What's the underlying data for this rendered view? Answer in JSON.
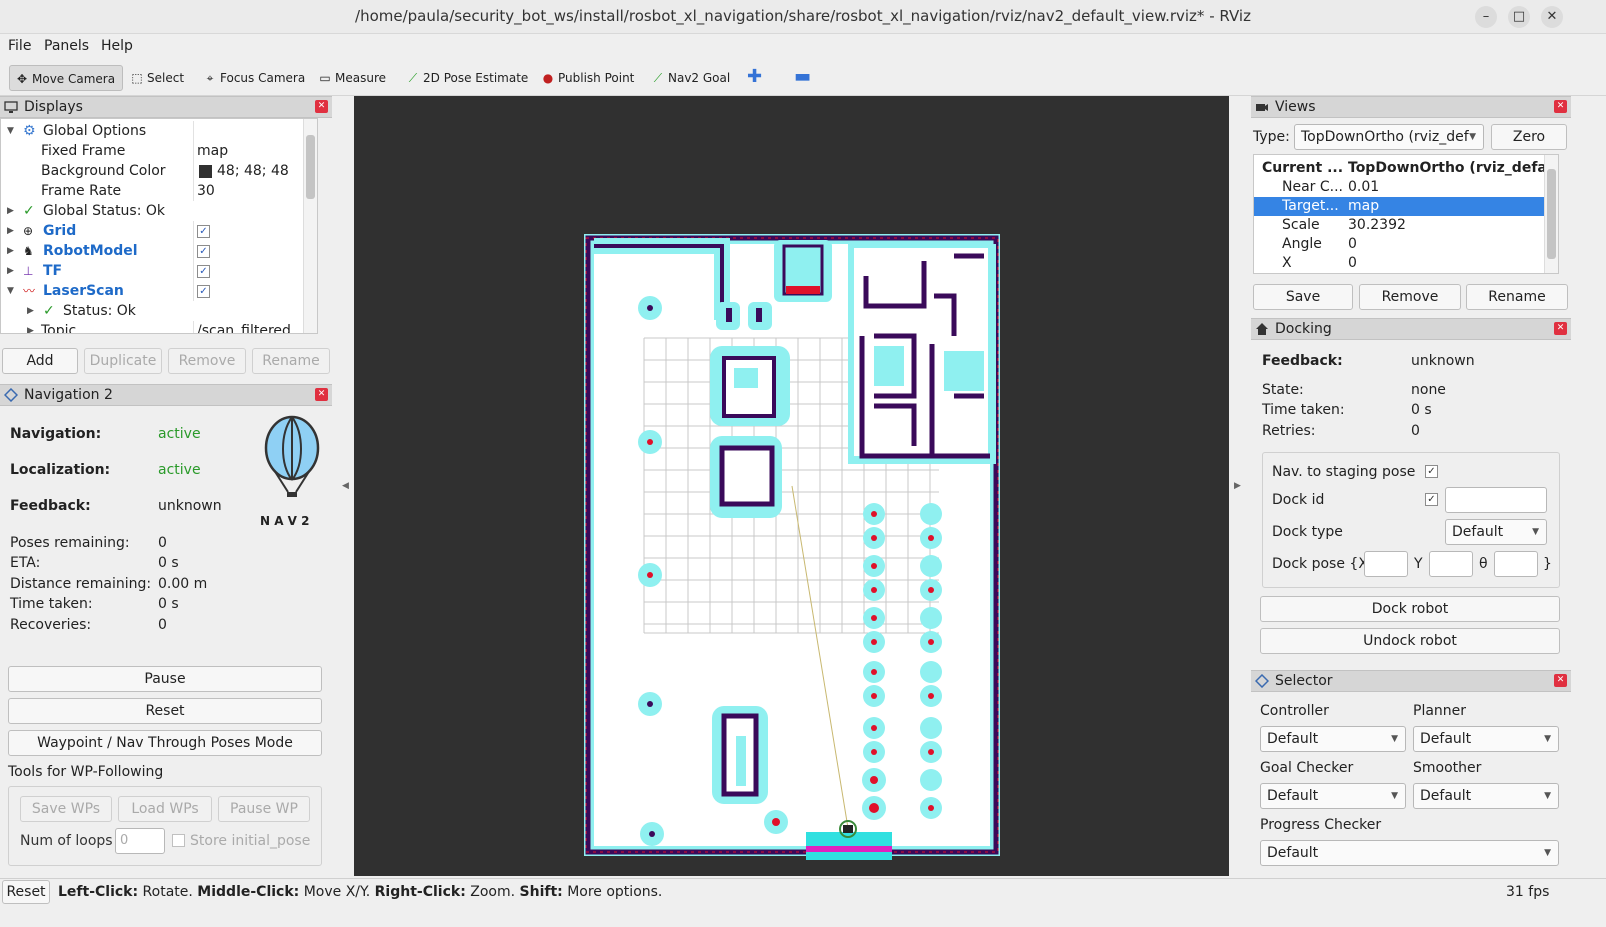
{
  "window": {
    "title": "/home/paula/security_bot_ws/install/rosbot_xl_navigation/share/rosbot_xl_navigation/rviz/nav2_default_view.rviz* - RViz",
    "minimize": "–",
    "maximize": "□",
    "close": "✕"
  },
  "menu": {
    "file": "File",
    "panels": "Panels",
    "help": "Help"
  },
  "toolbar": {
    "move_camera": "Move Camera",
    "select": "Select",
    "focus_camera": "Focus Camera",
    "measure": "Measure",
    "pose_estimate": "2D Pose Estimate",
    "publish_point": "Publish Point",
    "nav2_goal": "Nav2 Goal"
  },
  "displays": {
    "title": "Displays",
    "rows": [
      {
        "label": "Global Options",
        "value": ""
      },
      {
        "label": "Fixed Frame",
        "value": "map"
      },
      {
        "label": "Background Color",
        "value": "48; 48; 48"
      },
      {
        "label": "Frame Rate",
        "value": "30"
      },
      {
        "label": "Global Status: Ok",
        "value": ""
      },
      {
        "label": "Grid",
        "value": ""
      },
      {
        "label": "RobotModel",
        "value": ""
      },
      {
        "label": "TF",
        "value": ""
      },
      {
        "label": "LaserScan",
        "value": ""
      },
      {
        "label": "Status: Ok",
        "value": ""
      },
      {
        "label": "Topic",
        "value": "/scan_filtered"
      }
    ],
    "buttons": {
      "add": "Add",
      "duplicate": "Duplicate",
      "remove": "Remove",
      "rename": "Rename"
    },
    "bg_color": "#303030"
  },
  "nav2": {
    "title": "Navigation 2",
    "navigation_label": "Navigation:",
    "navigation_value": "active",
    "localization_label": "Localization:",
    "localization_value": "active",
    "feedback_label": "Feedback:",
    "feedback_value": "unknown",
    "logo_text": "N A V 2",
    "stats": [
      {
        "label": "Poses remaining:",
        "value": "0"
      },
      {
        "label": "ETA:",
        "value": "0 s"
      },
      {
        "label": "Distance remaining:",
        "value": "0.00 m"
      },
      {
        "label": "Time taken:",
        "value": "0 s"
      },
      {
        "label": "Recoveries:",
        "value": "0"
      }
    ],
    "pause": "Pause",
    "reset": "Reset",
    "waypoint_mode": "Waypoint / Nav Through Poses Mode",
    "wp_title": "Tools for WP-Following",
    "save_wps": "Save WPs",
    "load_wps": "Load WPs",
    "pause_wp": "Pause WP",
    "num_loops_label": "Num of loops",
    "num_loops_value": "0",
    "store_initial_pose": "Store initial_pose"
  },
  "views": {
    "title": "Views",
    "type_label": "Type:",
    "type_value": "TopDownOrtho (rviz_def",
    "zero": "Zero",
    "header_c1": "Current ...",
    "header_c2": "TopDownOrtho (rviz_defaul...",
    "rows": [
      {
        "label": "Near C...",
        "value": "0.01"
      },
      {
        "label": "Target...",
        "value": "map"
      },
      {
        "label": "Scale",
        "value": "30.2392"
      },
      {
        "label": "Angle",
        "value": "0"
      },
      {
        "label": "X",
        "value": "0"
      }
    ],
    "save": "Save",
    "remove": "Remove",
    "rename": "Rename"
  },
  "docking": {
    "title": "Docking",
    "feedback_label": "Feedback:",
    "feedback_value": "unknown",
    "state_label": "State:",
    "state_value": "none",
    "time_label": "Time taken:",
    "time_value": "0 s",
    "retries_label": "Retries:",
    "retries_value": "0",
    "staging_label": "Nav. to staging pose",
    "dock_id_label": "Dock id",
    "dock_type_label": "Dock type",
    "dock_type_value": "Default",
    "dock_pose_label": "Dock pose {X",
    "y_label": "Y",
    "theta_label": "θ",
    "close_brace": "}",
    "dock_robot": "Dock robot",
    "undock_robot": "Undock robot"
  },
  "selector": {
    "title": "Selector",
    "controller_label": "Controller",
    "controller_value": "Default",
    "planner_label": "Planner",
    "planner_value": "Default",
    "goal_checker_label": "Goal Checker",
    "goal_checker_value": "Default",
    "smoother_label": "Smoother",
    "smoother_value": "Default",
    "progress_checker_label": "Progress Checker",
    "progress_checker_value": "Default"
  },
  "status": {
    "reset": "Reset",
    "left_click": "Left-Click:",
    "left_click_desc": " Rotate.",
    "middle_click": "Middle-Click:",
    "middle_click_desc": " Move X/Y.",
    "right_click": "Right-Click:",
    "right_click_desc": " Zoom.",
    "shift": "Shift:",
    "shift_desc": " More options.",
    "fps": "31 fps"
  },
  "colors": {
    "costmap_cyan": "#8ff0f0",
    "obstacle_purple": "#3a0a5a",
    "laser_red": "#e0102a",
    "accent_blue": "#3584e4"
  }
}
